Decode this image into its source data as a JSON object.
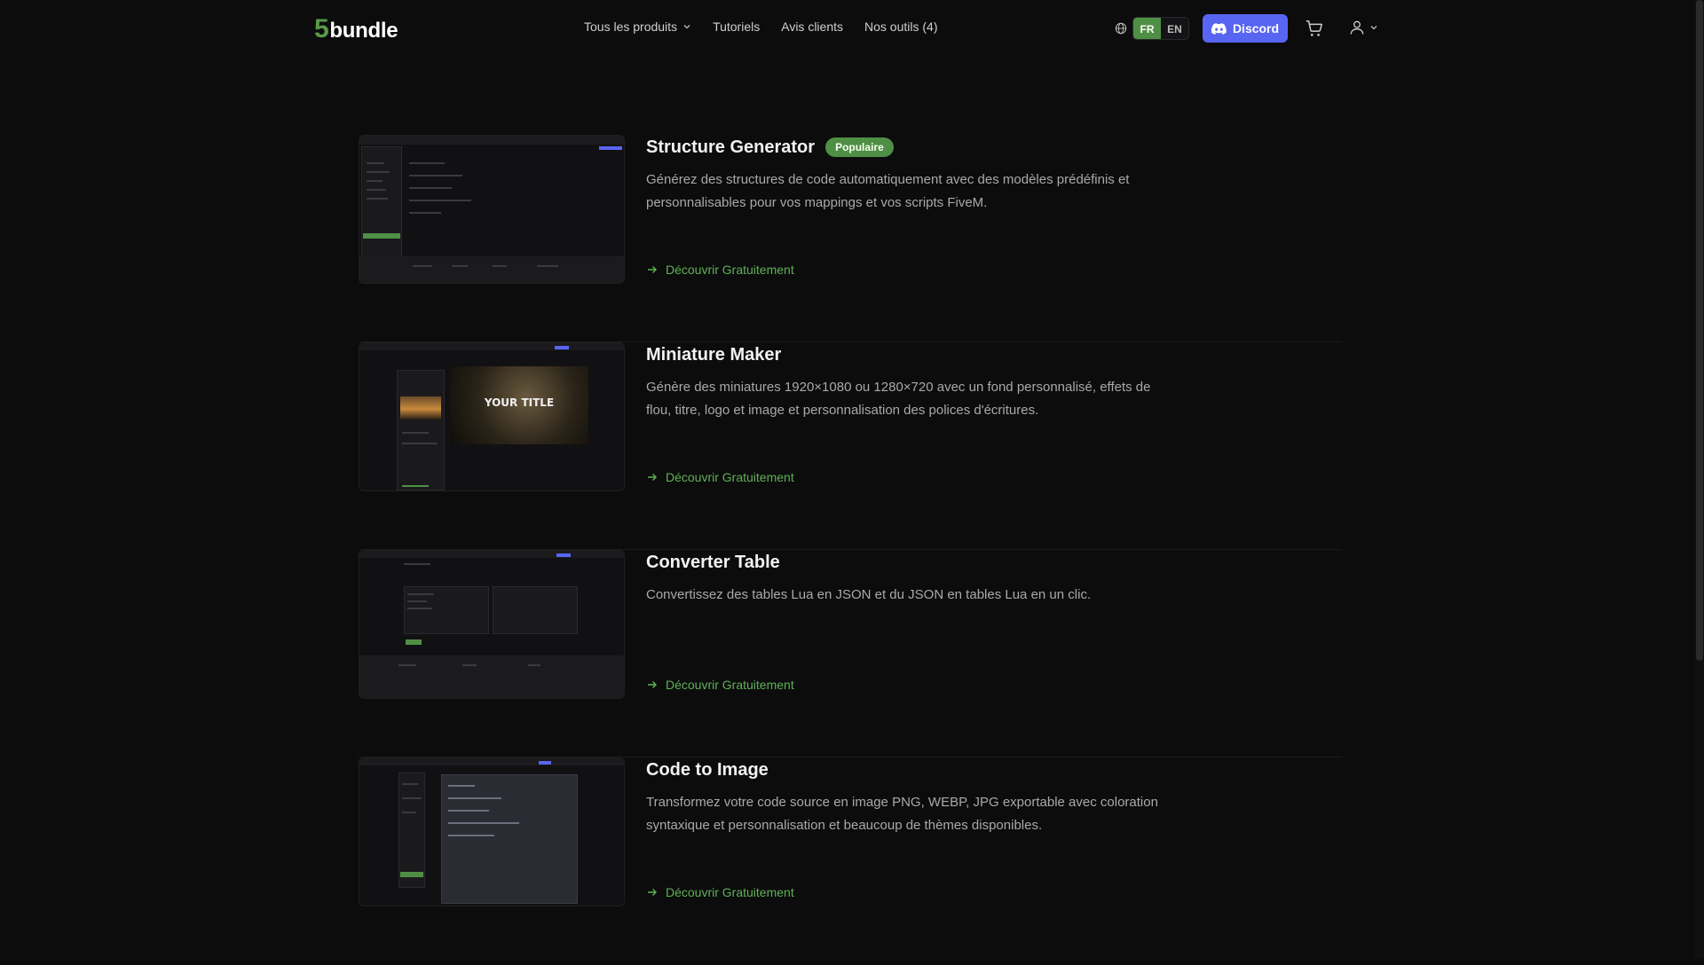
{
  "header": {
    "logo_num": "5",
    "logo_text": "bundle",
    "nav": [
      {
        "label": "Tous les produits",
        "has_dropdown": true
      },
      {
        "label": "Tutoriels",
        "has_dropdown": false
      },
      {
        "label": "Avis clients",
        "has_dropdown": false
      },
      {
        "label": "Nos outils (4)",
        "has_dropdown": false
      }
    ],
    "languages": [
      {
        "code": "FR",
        "active": true
      },
      {
        "code": "EN",
        "active": false
      }
    ],
    "discord_label": "Discord",
    "colors": {
      "brand_green": "#4f8f45",
      "discord": "#5865f2",
      "link_green": "#5fb255",
      "background": "#0c0c0d"
    },
    "icons": {
      "globe": "globe-icon",
      "discord": "discord-icon",
      "cart": "cart-icon",
      "user": "user-icon",
      "chevron": "chevron-down-icon"
    }
  },
  "products": [
    {
      "title": "Structure Generator",
      "badge": "Populaire",
      "description": "Générez des structures de code automatiquement avec des modèles prédéfinis et personnalisables pour vos mappings et vos scripts FiveM.",
      "link": "Découvrir Gratuitement"
    },
    {
      "title": "Miniature Maker",
      "badge": "",
      "description": "Génère des miniatures 1920×1080 ou 1280×720 avec un fond personnalisé, effets de flou, titre, logo et image et personnalisation des polices d'écritures.",
      "link": "Découvrir Gratuitement",
      "thumb_text": "YOUR TITLE"
    },
    {
      "title": "Converter Table",
      "badge": "",
      "description": "Convertissez des tables Lua en JSON et du JSON en tables Lua en un clic.",
      "link": "Découvrir Gratuitement"
    },
    {
      "title": "Code to Image",
      "badge": "",
      "description": "Transformez votre code source en image PNG, WEBP, JPG exportable avec coloration syntaxique et personnalisation et beaucoup de thèmes disponibles.",
      "link": "Découvrir Gratuitement"
    }
  ]
}
